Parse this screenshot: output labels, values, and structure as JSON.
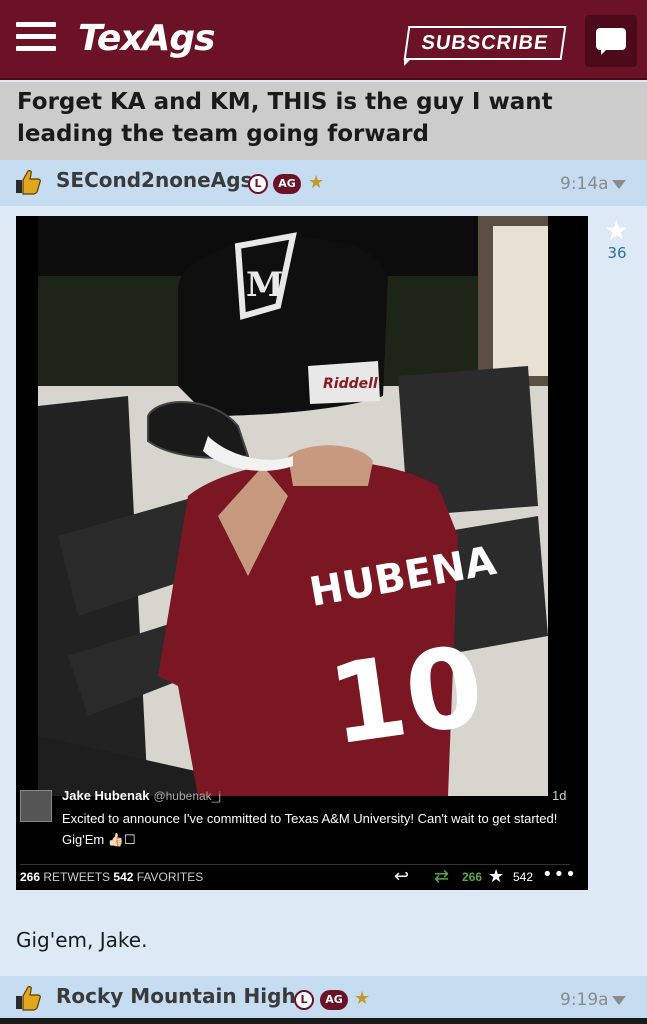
{
  "header": {
    "logo": "TexAgs",
    "subscribe_label": "SUBSCRIBE",
    "brand_color": "#6b1226"
  },
  "thread": {
    "title": "Forget KA and KM, THIS is the guy I want leading the team going forward"
  },
  "posts": [
    {
      "username": "SECond2noneAgs",
      "badge_l": "L",
      "badge_ag": "AG",
      "time": "9:14a",
      "votes": "36",
      "embed": {
        "jersey_name": "HUBENA",
        "jersey_number": "10",
        "helmet_letter": "M",
        "helmet_brand": "Riddell",
        "tweet": {
          "name": "Jake Hubenak",
          "handle": "@hubenak_j",
          "age": "1d",
          "text": "Excited to announce I've committed to Texas A&M University! Can't wait to get started! Gig'Em 👍🏻☐",
          "retweets": "266",
          "retweets_label": "RETWEETS",
          "favorites": "542",
          "favorites_label": "FAVORITES",
          "rt_count": "266",
          "fav_count": "542"
        }
      },
      "text": "Gig'em, Jake."
    },
    {
      "username": "Rocky Mountain High",
      "badge_l": "L",
      "badge_ag": "AG",
      "time": "9:19a"
    }
  ],
  "icons": {
    "menu": "hamburger-icon",
    "chat": "chat-bubble-icon",
    "thumb": "thumbs-up-icon",
    "star": "star-icon",
    "caret": "caret-down-icon"
  }
}
